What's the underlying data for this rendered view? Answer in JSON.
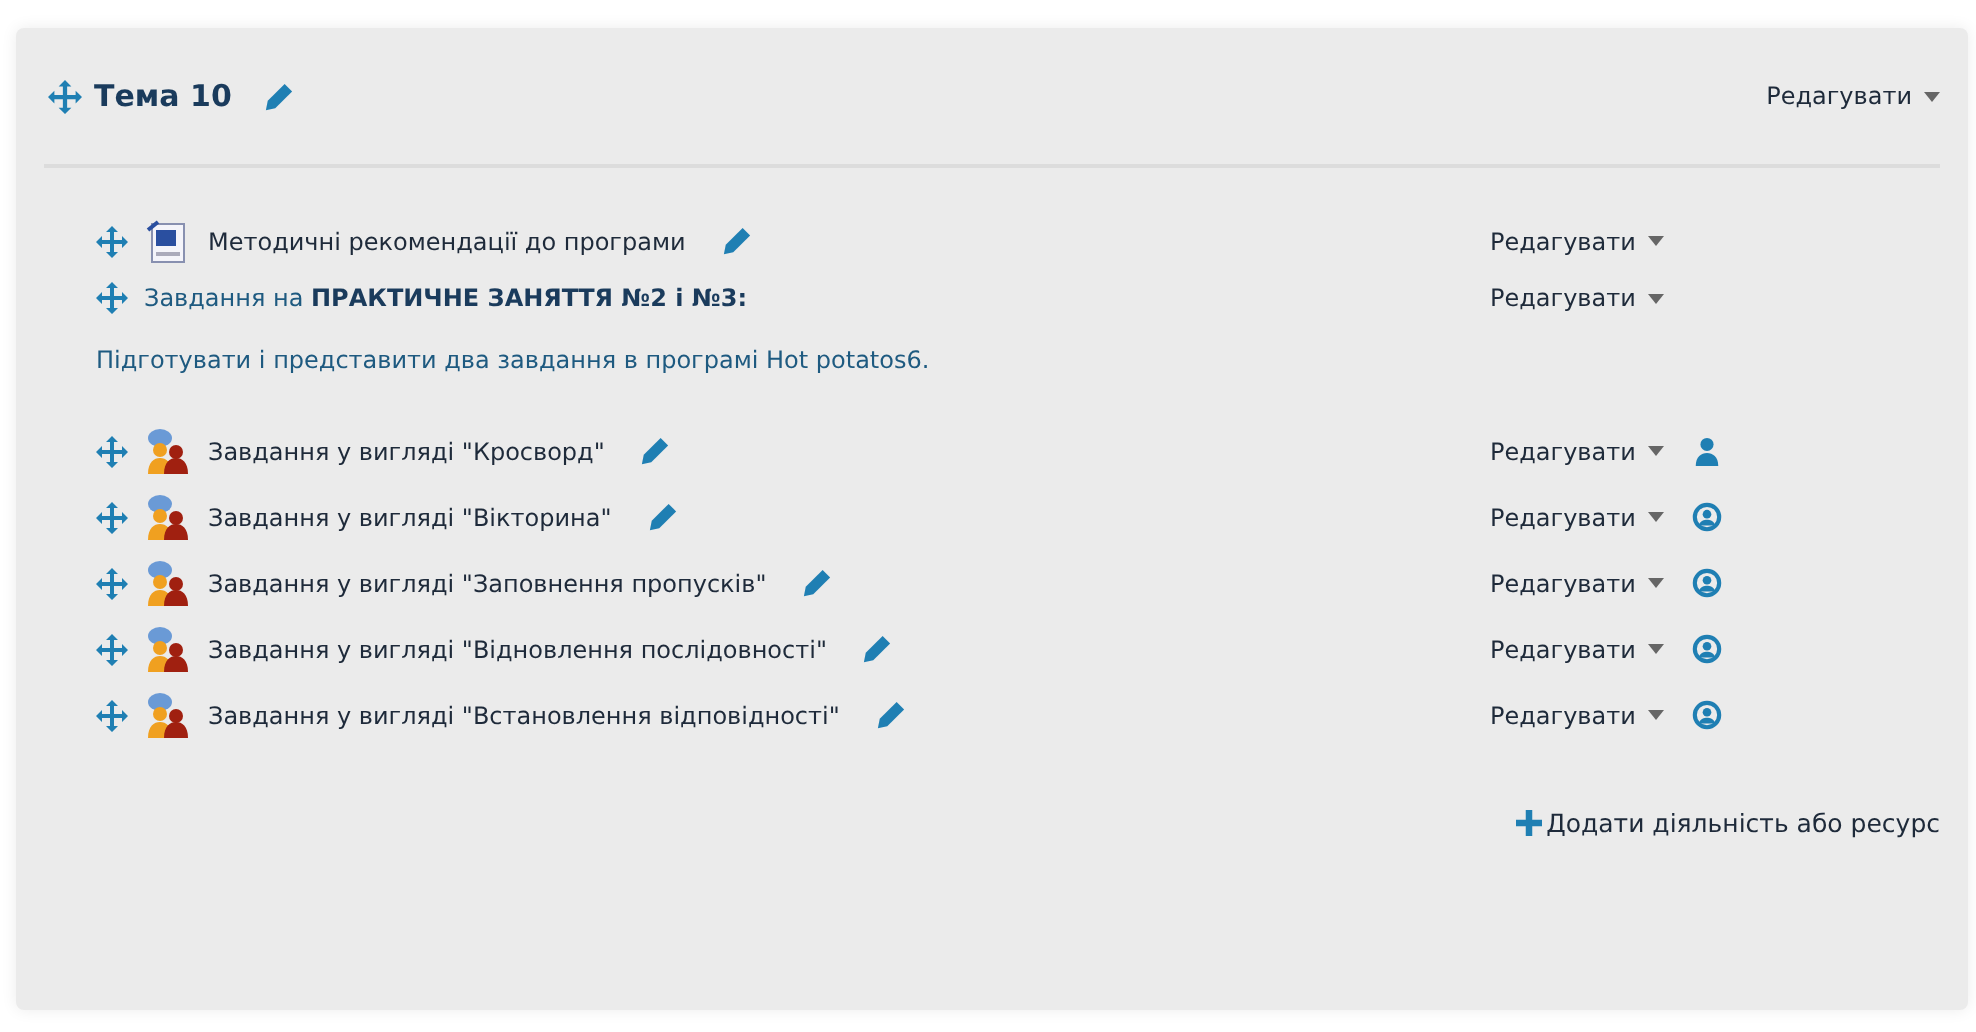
{
  "section": {
    "title": "Тема 10",
    "edit_menu": "Редагувати"
  },
  "items": [
    {
      "kind": "file",
      "name": "Методичні рекомендації до програми",
      "edit_menu": "Редагувати"
    },
    {
      "kind": "label",
      "name": "Завдання на **ПРАКТИЧНЕ ЗАНЯТТЯ №2 і №3:**",
      "description": "Підготувати і представити два завдання в програмі Hot potatos6.",
      "edit_menu": "Редагувати"
    },
    {
      "kind": "quiz",
      "name": "Завдання у вигляді \"Кросворд\"",
      "edit_menu": "Редагувати",
      "group_mode": false
    },
    {
      "kind": "quiz",
      "name": "Завдання у вигляді \"Вікторина\"",
      "edit_menu": "Редагувати",
      "group_mode": true
    },
    {
      "kind": "quiz",
      "name": "Завдання у вигляді \"Заповнення пропусків\"",
      "edit_menu": "Редагувати",
      "group_mode": true
    },
    {
      "kind": "quiz",
      "name": "Завдання у вигляді \"Відновлення послідовності\"",
      "edit_menu": "Редагувати",
      "group_mode": true
    },
    {
      "kind": "quiz",
      "name": "Завдання у вигляді \"Встановлення відповідності\"",
      "edit_menu": "Редагувати",
      "group_mode": true
    }
  ],
  "add_link": "Додати діяльність або ресурс"
}
